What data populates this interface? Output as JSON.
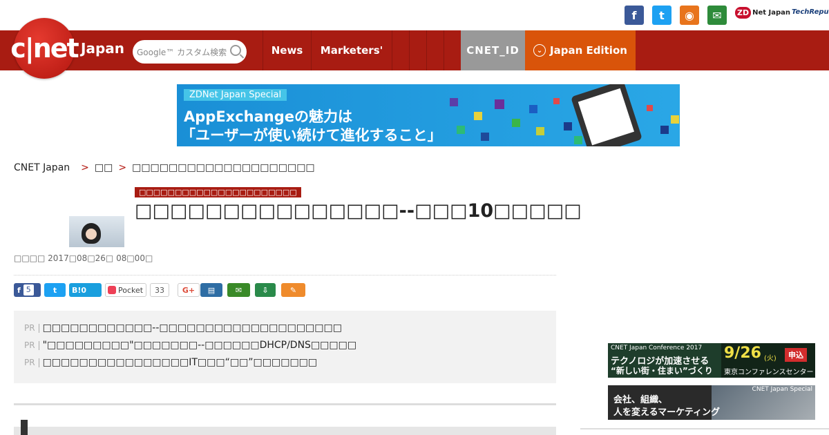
{
  "header": {
    "zdnet_label": "Net Japan",
    "zdnet_mark": "ZD",
    "techrepublic_label": "TechRepublic",
    "logo_text": "c|net",
    "logo_sub": "Japan",
    "search_placeholder": "Google™ カスタム検索"
  },
  "social": {
    "facebook": "f",
    "twitter": "t",
    "rss": "◉",
    "mail": "✉"
  },
  "nav": {
    "news": "News",
    "marketers": "Marketers'",
    "cnet_id": "CNET_ID",
    "japan_edition": "Japan Edition"
  },
  "banner": {
    "tag": "ZDNet Japan Special",
    "line1": "AppExchangeの魅力は",
    "line2": "「ユーザーが使い続けて進化すること」"
  },
  "breadcrumb": {
    "home": "CNET Japan",
    "sep": ">",
    "level1": "□□",
    "level2": "□□□□□□□□□□□□□□□□□□□□"
  },
  "article": {
    "category": "□□□□□□□□□□□□□□□□□□□□□□",
    "title": "□□□□□□□□□□□□□□□--□□□10□□□□□",
    "meta": "□□□□ 2017□08□26□ 08□00□"
  },
  "share": {
    "facebook_icon": "f",
    "facebook_count": "5",
    "twitter_icon": "t",
    "hatena": "B!0",
    "pocket": "Pocket",
    "pocket_count": "33",
    "gplus": "G+",
    "print_icon": "▤",
    "mail_icon": "✉",
    "download_icon": "⇩",
    "clip_icon": "✎"
  },
  "pr": {
    "tag": "PR",
    "items": [
      "□□□□□□□□□□□□--□□□□□□□□□□□□□□□□□□□□",
      "\"□□□□□□□□□\"□□□□□□□--□□□□□□DHCP/DNS□□□□□",
      "□□□□□□□□□□□□□□□□IT□□□“□□”□□□□□□□"
    ]
  },
  "ads": {
    "conf_top": "CNET Japan Conference 2017",
    "conf_line1": "テクノロジが加速させる",
    "conf_line2": "“新しい街・住まい”づくり",
    "conf_date": "9/26",
    "conf_day": "(火)",
    "conf_btn": "申込",
    "conf_venue": "東京コンファレンスセンター",
    "special_tag": "CNET Japan Special",
    "special_line1": "会社、組織、",
    "special_line2": "人を変えるマーケティング"
  }
}
